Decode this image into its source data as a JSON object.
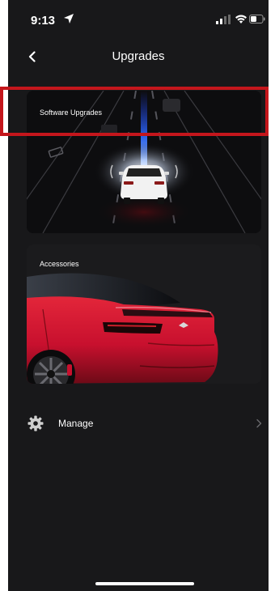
{
  "status_bar": {
    "time": "9:13"
  },
  "nav": {
    "title": "Upgrades"
  },
  "cards": {
    "software": {
      "label": "Software Upgrades"
    },
    "accessories": {
      "label": "Accessories"
    }
  },
  "list": {
    "manage": {
      "label": "Manage"
    }
  },
  "colors": {
    "background": "#18181a",
    "card": "#0d0d0f",
    "highlight": "#c4161c",
    "car_red": "#c8102e",
    "text": "#ffffff"
  },
  "icons": [
    "location-icon",
    "signal-icon",
    "wifi-icon",
    "battery-icon",
    "back-arrow-icon",
    "gear-icon",
    "chevron-right-icon"
  ]
}
